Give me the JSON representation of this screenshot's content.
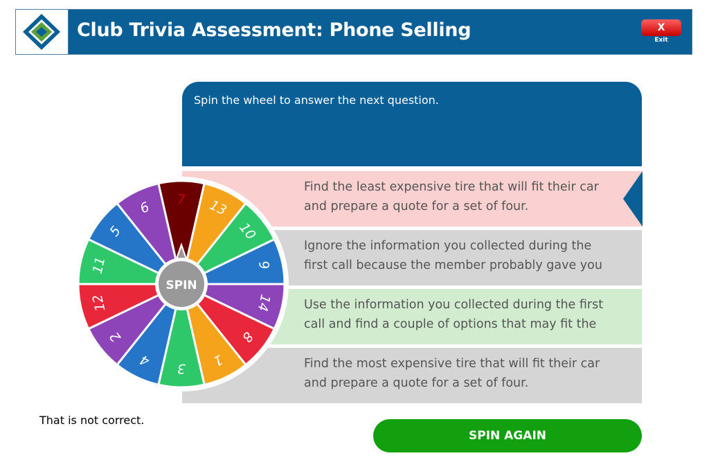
{
  "header": {
    "title": "Club Trivia Assessment: Phone Selling",
    "exit_symbol": "X",
    "exit_label": "Exit"
  },
  "question": {
    "text": "Spin the wheel to answer the next question."
  },
  "answers": [
    {
      "line1": "Find the least expensive tire that will fit their car",
      "line2": "and prepare a quote for a set of four.",
      "color": "#fbd0d0"
    },
    {
      "line1": "Ignore the information you collected during the",
      "line2": "first call because the member probably gave you",
      "color": "#d5d5d5"
    },
    {
      "line1": "Use the information you collected during the first",
      "line2": "call and find a couple of options that may fit the",
      "color": "#d2ecd0"
    },
    {
      "line1": "Find the most expensive tire that will fit their car",
      "line2": "and prepare a quote for a set of four.",
      "color": "#d5d5d5"
    }
  ],
  "wheel": {
    "center_label": "SPIN",
    "segments": [
      {
        "label": "7",
        "color": "#6b0000",
        "text_color": "#c0000e"
      },
      {
        "label": "13",
        "color": "#f5a31a",
        "text_color": "#ffffff"
      },
      {
        "label": "10",
        "color": "#2ec86a",
        "text_color": "#ffffff"
      },
      {
        "label": "9",
        "color": "#2576c8",
        "text_color": "#ffffff"
      },
      {
        "label": "14",
        "color": "#8c44b8",
        "text_color": "#ffffff"
      },
      {
        "label": "8",
        "color": "#e8283a",
        "text_color": "#ffffff"
      },
      {
        "label": "1",
        "color": "#f5a31a",
        "text_color": "#ffffff"
      },
      {
        "label": "3",
        "color": "#2ec86a",
        "text_color": "#ffffff"
      },
      {
        "label": "4",
        "color": "#2576c8",
        "text_color": "#ffffff"
      },
      {
        "label": "2",
        "color": "#8c44b8",
        "text_color": "#ffffff"
      },
      {
        "label": "12",
        "color": "#e8283a",
        "text_color": "#ffffff"
      },
      {
        "label": "11",
        "color": "#2ec86a",
        "text_color": "#ffffff"
      },
      {
        "label": "5",
        "color": "#2576c8",
        "text_color": "#ffffff"
      },
      {
        "label": "6",
        "color": "#8c44b8",
        "text_color": "#ffffff"
      }
    ]
  },
  "feedback": {
    "text": "That is not correct."
  },
  "spin_again": {
    "label": "SPIN AGAIN"
  },
  "colors": {
    "header_blue": "#0a5f96",
    "spin_again_green": "#13a00f",
    "exit_red": "#d40000"
  }
}
